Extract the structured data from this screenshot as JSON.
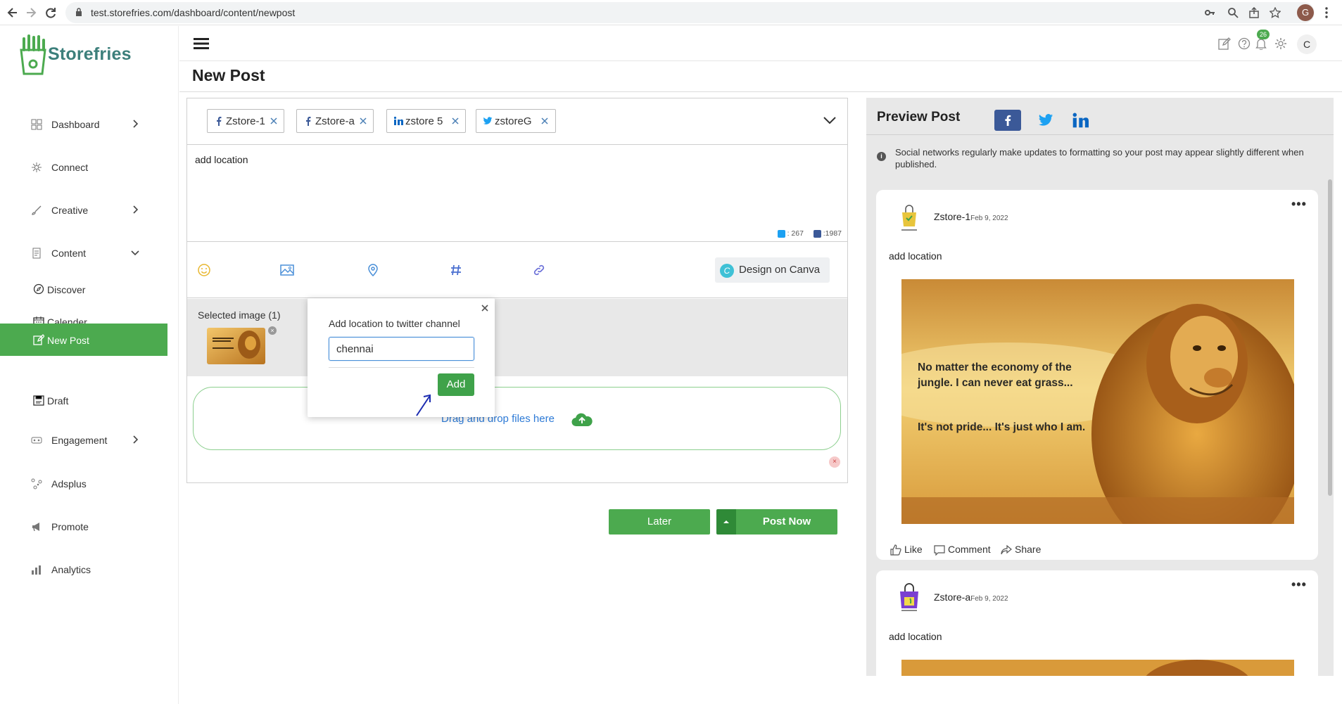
{
  "browser": {
    "url": "test.storefries.com/dashboard/content/newpost",
    "profile_initial": "G"
  },
  "sidebar": {
    "brand": "Storefries",
    "items": [
      {
        "label": "Dashboard",
        "icon": "grid-icon"
      },
      {
        "label": "Connect",
        "icon": "connect-icon"
      },
      {
        "label": "Creative",
        "icon": "brush-icon"
      },
      {
        "label": "Content",
        "icon": "content-icon"
      },
      {
        "label": "Engagement",
        "icon": "engagement-icon"
      },
      {
        "label": "Adsplus",
        "icon": "adsplus-icon"
      },
      {
        "label": "Promote",
        "icon": "megaphone-icon"
      },
      {
        "label": "Analytics",
        "icon": "bar-chart-icon"
      }
    ],
    "content_sub": [
      {
        "label": "Discover",
        "icon": "compass-icon"
      },
      {
        "label": "Calender",
        "icon": "calendar-icon"
      },
      {
        "label": "New Post",
        "icon": "edit-icon"
      },
      {
        "label": "Draft",
        "icon": "draft-icon"
      }
    ]
  },
  "topbar": {
    "notification_count": "26",
    "user_initial": "C"
  },
  "page": {
    "title": "New Post"
  },
  "editor": {
    "channels": [
      {
        "network": "facebook",
        "name": "Zstore-1"
      },
      {
        "network": "facebook",
        "name": "Zstore-a"
      },
      {
        "network": "linkedin",
        "name": "zstore 5"
      },
      {
        "network": "twitter",
        "name": "zstoreG"
      }
    ],
    "post_text": "add location",
    "twitter_count": ": 267",
    "facebook_count": ":1987",
    "canva_label": "Design on Canva",
    "selected_label": "Selected image (1)",
    "drop_text": "Drag and drop files here"
  },
  "location_popup": {
    "title": "Add location to twitter channel",
    "value": "chennai",
    "add_label": "Add"
  },
  "actions": {
    "later_label": "Later",
    "post_now_label": "Post Now"
  },
  "preview": {
    "title": "Preview Post",
    "info": "Social networks regularly make updates to formatting so your post may appear slightly different when published.",
    "posts": [
      {
        "name": "Zstore-1",
        "date": "Feb 9, 2022",
        "text": "add location"
      },
      {
        "name": "Zstore-a",
        "date": "Feb 9, 2022",
        "text": "add location"
      }
    ],
    "image_quote_1": "No matter the economy of the",
    "image_quote_2": "jungle. I can never eat grass...",
    "image_quote_3": "It's not pride... It's just who I am.",
    "like_label": "Like",
    "comment_label": "Comment",
    "share_label": "Share"
  },
  "colors": {
    "accent_green": "#4caa4f",
    "facebook_blue": "#3b5998",
    "twitter_blue": "#1da1f2",
    "linkedin_blue": "#0a66c2"
  }
}
